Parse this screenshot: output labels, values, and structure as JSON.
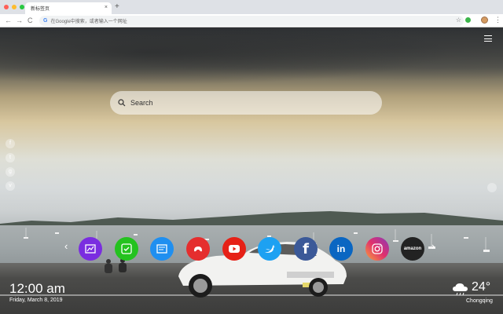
{
  "browser": {
    "tab_title": "新标签页",
    "tab_close": "×",
    "new_tab": "+",
    "nav": {
      "back": "←",
      "forward": "→",
      "reload": "C"
    },
    "omnibox_google": "G",
    "omnibox_placeholder": "在Google中搜索，或者输入一个网址",
    "star": "☆",
    "menu": "⋮"
  },
  "search": {
    "placeholder": "Search"
  },
  "social_icons": [
    {
      "name": "facebook-icon",
      "glyph": "f"
    },
    {
      "name": "twitter-icon",
      "glyph": "t"
    },
    {
      "name": "google-icon",
      "glyph": "g"
    },
    {
      "name": "vk-icon",
      "glyph": "v"
    }
  ],
  "apps": [
    {
      "name": "wallpaper-app",
      "color": "#7a2de0",
      "label": ""
    },
    {
      "name": "check-app",
      "color": "#24c21f",
      "label": ""
    },
    {
      "name": "notes-app",
      "color": "#1f8ff0",
      "label": ""
    },
    {
      "name": "games-app",
      "color": "#e52e2e",
      "label": ""
    },
    {
      "name": "youtube-app",
      "color": "#e62117",
      "label": ""
    },
    {
      "name": "twitter-app",
      "color": "#1da1f2",
      "label": ""
    },
    {
      "name": "facebook-app",
      "color": "#3b5998",
      "label": "f"
    },
    {
      "name": "linkedin-app",
      "color": "#0a66c2",
      "label": "in"
    },
    {
      "name": "instagram-app",
      "color": "#d1348a",
      "label": ""
    },
    {
      "name": "amazon-app",
      "color": "#222222",
      "label": "amazon"
    }
  ],
  "nav_arrows": {
    "prev": "‹",
    "next": "›"
  },
  "clock": {
    "time": "12:00 am",
    "date": "Friday, March 8, 2019"
  },
  "weather": {
    "temp": "24°",
    "city": "Chongqing",
    "icon": "cloud-rain-icon"
  }
}
